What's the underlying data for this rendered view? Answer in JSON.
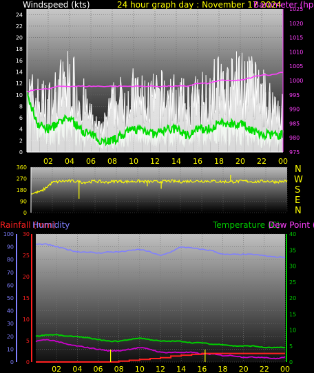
{
  "header": {
    "left_label": "Windspeed (kts)",
    "center_label": "24 hour graph day : November 17 2024",
    "right_label": "Barometer (hpa)"
  },
  "colors": {
    "wind_gust": "#ffffff",
    "wind_avg": "#00dd00",
    "wind_fill": "#ccf5cc",
    "barometer": "#ff40ff",
    "direction": "#ffff00",
    "rainfall": "#ff2020",
    "humidity": "#8080ff",
    "temperature": "#00cc00",
    "dewpoint": "#cc00cc",
    "yellow_label": "#ffff00",
    "left_axis_color": "#ffffff",
    "baro_axis_color": "#ff40ff"
  },
  "direction_labels": [
    "N",
    "W",
    "S",
    "E",
    "N"
  ],
  "chart_data": [
    {
      "type": "line",
      "title": "24 hour graph day : November 17 2024",
      "x_ticks": [
        "02",
        "04",
        "06",
        "08",
        "10",
        "12",
        "14",
        "16",
        "18",
        "20",
        "22",
        "00"
      ],
      "y_left_label": "Windspeed (kts)",
      "y_left_ticks": [
        "0",
        "2",
        "4",
        "6",
        "8",
        "10",
        "12",
        "14",
        "16",
        "18",
        "20",
        "22",
        "24"
      ],
      "y_left_lim": [
        0,
        25
      ],
      "y_right_label": "Barometer (hpa)",
      "y_right_ticks": [
        "975",
        "980",
        "985",
        "990",
        "995",
        "1000",
        "1005",
        "1010",
        "1015",
        "1020",
        "1025"
      ],
      "y_right_lim": [
        975,
        1025
      ],
      "x_hours": [
        0,
        1,
        2,
        3,
        4,
        5,
        6,
        7,
        8,
        9,
        10,
        11,
        12,
        13,
        14,
        15,
        16,
        17,
        18,
        19,
        20,
        21,
        22,
        23,
        24
      ],
      "series": [
        {
          "name": "Gust",
          "values": [
            12,
            11,
            10,
            13,
            15,
            12,
            7,
            4,
            10,
            11,
            12,
            11,
            11,
            12,
            11,
            10,
            11,
            13,
            14,
            13,
            15,
            14,
            12,
            10,
            9
          ]
        },
        {
          "name": "Windspeed",
          "values": [
            10,
            5,
            4,
            5,
            6,
            4,
            3,
            2,
            2,
            3,
            4,
            4,
            3,
            4,
            4,
            3,
            4,
            4,
            5,
            5,
            5,
            4,
            3,
            3,
            3
          ]
        },
        {
          "name": "Barometer",
          "values": [
            996,
            997,
            997,
            998,
            998,
            998,
            998,
            998,
            998,
            998,
            998,
            998,
            998,
            998,
            998,
            998,
            999,
            999,
            1000,
            1000,
            1000,
            1001,
            1002,
            1002,
            1003
          ]
        }
      ]
    },
    {
      "type": "line",
      "y_ticks": [
        "0",
        "90",
        "180",
        "270",
        "360"
      ],
      "y_lim": [
        0,
        360
      ],
      "x_hours": [
        0,
        1,
        2,
        3,
        4,
        5,
        6,
        7,
        8,
        9,
        10,
        11,
        12,
        13,
        14,
        15,
        16,
        17,
        18,
        19,
        20,
        21,
        22,
        23,
        24
      ],
      "series": [
        {
          "name": "Wind direction",
          "values": [
            150,
            170,
            240,
            250,
            250,
            240,
            250,
            240,
            250,
            245,
            250,
            245,
            245,
            250,
            245,
            250,
            250,
            250,
            245,
            245,
            250,
            245,
            250,
            245,
            250
          ]
        }
      ]
    },
    {
      "type": "line",
      "left_labels": [
        "Rainfall (mm)",
        "Humidity"
      ],
      "right_labels": [
        "Temperature (C)",
        "Dew Point (C)"
      ],
      "x_ticks": [
        "02",
        "04",
        "06",
        "08",
        "10",
        "12",
        "14",
        "16",
        "18",
        "20",
        "22",
        "00"
      ],
      "humidity_ticks": [
        "0",
        "10",
        "20",
        "30",
        "40",
        "50",
        "60",
        "70",
        "80",
        "90",
        "100"
      ],
      "humidity_lim": [
        0,
        100
      ],
      "rain_ticks": [
        "0",
        "5",
        "10",
        "15",
        "20",
        "25",
        "30"
      ],
      "rain_lim": [
        0,
        30
      ],
      "temp_ticks": [
        "0",
        "5",
        "10",
        "15",
        "20",
        "25",
        "30",
        "35",
        "40"
      ],
      "temp_lim": [
        0,
        40
      ],
      "x_hours": [
        0,
        1,
        2,
        3,
        4,
        5,
        6,
        7,
        8,
        9,
        10,
        11,
        12,
        13,
        14,
        15,
        16,
        17,
        18,
        19,
        20,
        21,
        22,
        23,
        24
      ],
      "series": [
        {
          "name": "Humidity",
          "values": [
            92,
            92,
            90,
            88,
            86,
            86,
            85,
            86,
            86,
            87,
            88,
            86,
            83,
            86,
            90,
            89,
            88,
            87,
            84,
            84,
            84,
            84,
            83,
            82,
            82
          ]
        },
        {
          "name": "Temperature",
          "values": [
            8,
            8.5,
            8.5,
            8,
            8,
            7.5,
            7,
            6.5,
            6.5,
            7,
            7.5,
            7,
            6.5,
            6.5,
            6.5,
            6,
            6,
            5.5,
            5.5,
            5,
            5,
            5,
            4.5,
            4.5,
            4.5
          ]
        },
        {
          "name": "Dew Point",
          "values": [
            6.5,
            7,
            6.5,
            5.5,
            5,
            4.5,
            4,
            3.5,
            3.5,
            4,
            4.5,
            4,
            3,
            3,
            3,
            3,
            2.5,
            2.5,
            2,
            2,
            1.5,
            1.5,
            1.5,
            1,
            1.5
          ]
        },
        {
          "name": "Rainfall",
          "values": [
            0,
            0,
            0,
            0,
            0,
            0,
            0,
            0,
            0.2,
            0.4,
            0.6,
            0.8,
            1,
            1.4,
            1.6,
            1.8,
            2,
            2,
            2,
            2,
            2,
            2,
            2,
            2,
            2
          ]
        }
      ]
    }
  ]
}
